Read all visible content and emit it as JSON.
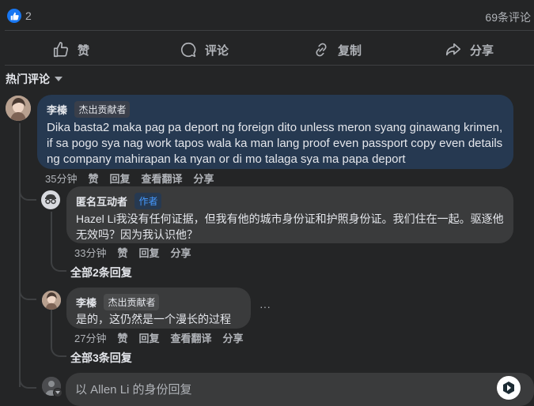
{
  "reactions": {
    "count": "2",
    "comment_total": "69条评论"
  },
  "actions": {
    "like": "赞",
    "comment": "评论",
    "copy": "复制",
    "share": "分享"
  },
  "sort": {
    "label": "热门评论"
  },
  "comment1": {
    "author": "李榛",
    "badge": "杰出贡献者",
    "text": "Dika basta2 maka pag pa deport ng foreign dito unless meron syang ginawang krimen, if sa pogo sya nag work tapos wala ka man lang proof even passport copy even details ng company mahirapan ka nyan or di mo talaga sya ma papa deport",
    "time": "35分钟",
    "like": "赞",
    "reply": "回复",
    "translate": "查看翻译",
    "share": "分享"
  },
  "reply1": {
    "author": "匿名互动者",
    "badge": "作者",
    "text": "Hazel Li我没有任何证据，但我有他的城市身份证和护照身份证。我们住在一起。驱逐他无效吗？因为我认识他？",
    "time": "33分钟",
    "like": "赞",
    "reply": "回复",
    "share": "分享",
    "more": "全部2条回复"
  },
  "reply2": {
    "author": "李榛",
    "badge": "杰出贡献者",
    "text": "是的，这仍然是一个漫长的过程",
    "options": "···",
    "time": "27分钟",
    "like": "赞",
    "reply": "回复",
    "translate": "查看翻译",
    "share": "分享",
    "more": "全部3条回复"
  },
  "composer": {
    "placeholder": "以 Allen Li 的身份回复"
  },
  "colors": {
    "accent": "#1877f2",
    "highlight_bubble": "#263951",
    "bubble": "#3a3b3c",
    "background": "#242526"
  }
}
